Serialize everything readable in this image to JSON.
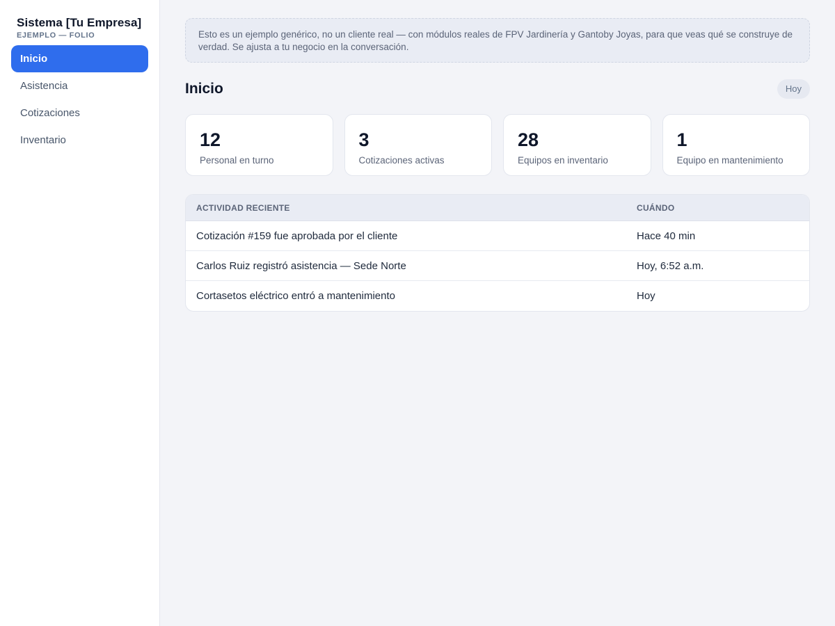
{
  "brand": {
    "title": "Sistema [Tu Empresa]",
    "subtitle": "EJEMPLO — FOLIO"
  },
  "sidebar": {
    "items": [
      {
        "label": "Inicio",
        "active": true
      },
      {
        "label": "Asistencia",
        "active": false
      },
      {
        "label": "Cotizaciones",
        "active": false
      },
      {
        "label": "Inventario",
        "active": false
      }
    ]
  },
  "notice": {
    "text": "Esto es un ejemplo genérico, no un cliente real — con módulos reales de FPV Jardinería y Gantoby Joyas, para que veas qué se construye de verdad. Se ajusta a tu negocio en la conversación."
  },
  "header": {
    "title": "Inicio",
    "date_pill": "Hoy"
  },
  "stats": [
    {
      "value": "12",
      "label": "Personal en turno"
    },
    {
      "value": "3",
      "label": "Cotizaciones activas"
    },
    {
      "value": "28",
      "label": "Equipos en inventario"
    },
    {
      "value": "1",
      "label": "Equipo en mantenimiento"
    }
  ],
  "activity": {
    "columns": [
      "ACTIVIDAD RECIENTE",
      "CUÁNDO"
    ],
    "rows": [
      {
        "text": "Cotización #159 fue aprobada por el cliente",
        "when": "Hace 40 min"
      },
      {
        "text": "Carlos Ruiz registró asistencia — Sede Norte",
        "when": "Hoy, 6:52 a.m."
      },
      {
        "text": "Cortasetos eléctrico entró a mantenimiento",
        "when": "Hoy"
      }
    ]
  },
  "colors": {
    "accent": "#2f6ded",
    "background": "#f3f4f8",
    "sidebar": "#ffffff"
  }
}
